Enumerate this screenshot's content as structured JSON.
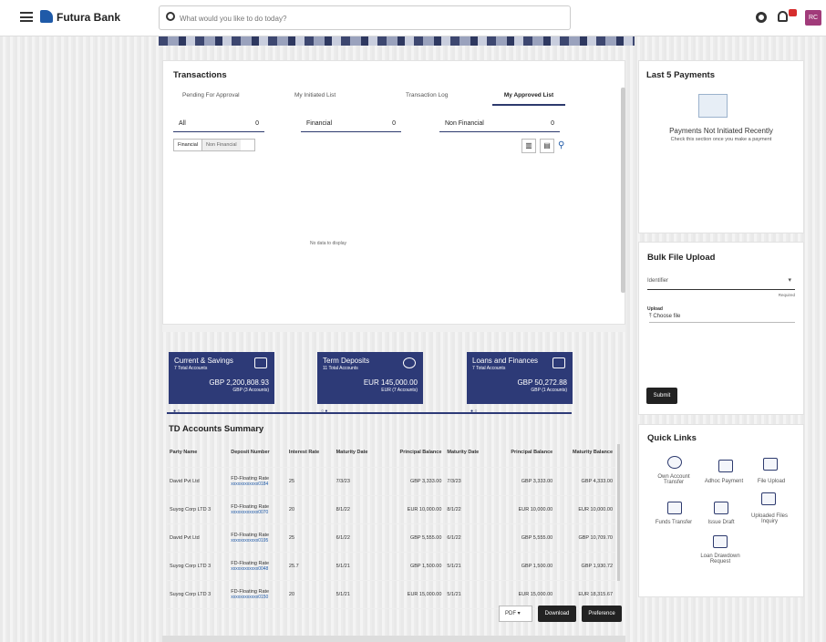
{
  "app": {
    "brand": "Futura Bank",
    "search_placeholder": "What would you like to do today?",
    "user_initials": "RC"
  },
  "transactions": {
    "title": "Transactions",
    "tabs": [
      "Pending For Approval",
      "My Initiated List",
      "Transaction Log",
      "My Approved List"
    ],
    "segments": [
      {
        "label": "All",
        "count": "0"
      },
      {
        "label": "Financial",
        "count": "0"
      },
      {
        "label": "Non Financial",
        "count": "0"
      }
    ],
    "filters": [
      "Financial",
      "Non Financial"
    ],
    "empty": "No data to display"
  },
  "payments": {
    "title": "Last 5 Payments",
    "heading": "Payments Not Initiated Recently",
    "sub": "Check this section once you make a payment"
  },
  "bulk": {
    "title": "Bulk File Upload",
    "identifier": "Identifier",
    "required": "Required",
    "upload": "Upload",
    "choose": "Choose file",
    "submit": "Submit"
  },
  "accounts": [
    {
      "title": "Current & Savings",
      "sub": "7 Total Accounts",
      "amount": "GBP 2,200,808.93",
      "detail": "GBP (3 Accounts)"
    },
    {
      "title": "Term Deposits",
      "sub": "11 Total Accounts",
      "amount": "EUR 145,000.00",
      "detail": "EUR (7 Accounts)"
    },
    {
      "title": "Loans and Finances",
      "sub": "7 Total Accounts",
      "amount": "GBP 50,272.88",
      "detail": "GBP (1 Accounts)"
    }
  ],
  "summary": {
    "title": "TD Accounts Summary",
    "headers": [
      "Party Name",
      "Deposit Number",
      "Interest Rate",
      "Maturity Date",
      "Principal Balance",
      "Maturity Date",
      "Principal Balance",
      "Maturity Balance"
    ],
    "rows": [
      [
        "David Pvt Ltd",
        "FD-Floating Rate",
        "xxxxxxxxxxxx0184",
        "25",
        "7/3/23",
        "GBP 3,333.00",
        "7/3/23",
        "GBP 3,333.00",
        "GBP 4,333.00"
      ],
      [
        "Suyog Corp LTD 3",
        "FD-Floating Rate",
        "xxxxxxxxxxxx0070",
        "20",
        "8/1/22",
        "EUR 10,000.00",
        "8/1/22",
        "EUR 10,000.00",
        "EUR 10,000.00"
      ],
      [
        "David Pvt Ltd",
        "FD-Floating Rate",
        "xxxxxxxxxxxx0195",
        "25",
        "6/1/22",
        "GBP 5,555.00",
        "6/1/22",
        "GBP 5,555.00",
        "GBP 10,709.70"
      ],
      [
        "Suyog Corp LTD 3",
        "FD-Floating Rate",
        "xxxxxxxxxxxx0048",
        "25.7",
        "5/1/21",
        "GBP 1,500.00",
        "5/1/21",
        "GBP 1,500.00",
        "GBP 1,930.72"
      ],
      [
        "Suyog Corp LTD 3",
        "FD-Floating Rate",
        "xxxxxxxxxxxx0150",
        "20",
        "5/1/21",
        "EUR 15,000.00",
        "5/1/21",
        "EUR 15,000.00",
        "EUR 18,315.67"
      ]
    ],
    "format": "PDF",
    "download": "Download",
    "preference": "Preference"
  },
  "quick": {
    "title": "Quick Links",
    "items": [
      "Own Account Transfer",
      "Adhoc Payment",
      "File Upload",
      "Funds Transfer",
      "Issue Draft",
      "Uploaded Files Inquiry",
      "Loan Drawdown Request"
    ]
  }
}
